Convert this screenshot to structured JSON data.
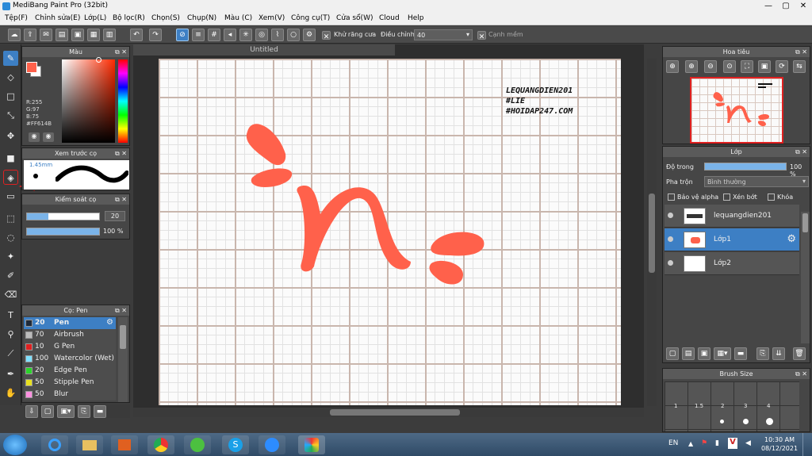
{
  "window": {
    "title": "MediBang Paint Pro (32bit)",
    "minimize": "—",
    "maximize": "▢",
    "close": "✕"
  },
  "menu": [
    "Tệp(F)",
    "Chỉnh sửa(E)",
    "Lớp(L)",
    "Bộ lọc(R)",
    "Chọn(S)",
    "Chụp(N)",
    "Màu (C)",
    "Xem(V)",
    "Công cụ(T)",
    "Cửa sổ(W)",
    "Cloud",
    "Help"
  ],
  "toolbar": {
    "antialias_label": "Khử răng cưa",
    "adjust_label": "Điều chỉnh",
    "adjust_value": "40",
    "sharp_label": "Cạnh mềm"
  },
  "color_panel": {
    "title": "Màu",
    "r": "R:255",
    "g": "G:97",
    "b": "B:75",
    "hex": "#FF614B",
    "fg_color": "#FF614B",
    "accent": "#3D7FC4"
  },
  "preview_panel": {
    "title": "Xem trước cọ",
    "size": "1.45mm"
  },
  "control_panel": {
    "title": "Kiểm soát cọ",
    "size_value": "20",
    "opacity_value": "100 %",
    "size_level": 0.3,
    "opacity_level": 1.0
  },
  "brush_panel": {
    "title": "Cọ: Pen",
    "items": [
      {
        "size": "20",
        "name": "Pen",
        "color": "#1e2a3a"
      },
      {
        "size": "70",
        "name": "Airbrush",
        "color": "#bbbbbb"
      },
      {
        "size": "10",
        "name": "G Pen",
        "color": "#e02020"
      },
      {
        "size": "100",
        "name": "Watercolor (Wet)",
        "color": "#7fe0ff"
      },
      {
        "size": "20",
        "name": "Edge Pen",
        "color": "#2ad42a"
      },
      {
        "size": "50",
        "name": "Stipple Pen",
        "color": "#e8e020"
      },
      {
        "size": "50",
        "name": "Blur",
        "color": "#ff90e0"
      }
    ]
  },
  "canvas": {
    "title": "Untitled",
    "watermark": [
      "LEQUANGDIEN201",
      "#LIE",
      "#HOIDAP247.COM"
    ]
  },
  "navigator": {
    "title": "Hoa tiêu"
  },
  "layer_panel": {
    "title": "Lớp",
    "opacity_label": "Độ trong",
    "opacity_value": "100 %",
    "blend_label": "Pha trộn",
    "blend_value": "Bình thường",
    "protect_alpha": "Bảo vệ alpha",
    "clipping": "Xén bớt",
    "lock": "Khóa",
    "layers": [
      "lequangdien201",
      "Lớp1",
      "Lớp2"
    ]
  },
  "brush_size_panel": {
    "title": "Brush Size",
    "sizes": [
      "1",
      "1.5",
      "2",
      "3",
      "4"
    ]
  },
  "taskbar": {
    "lang": "EN",
    "time": "10:30 AM",
    "date": "08/12/2021"
  }
}
